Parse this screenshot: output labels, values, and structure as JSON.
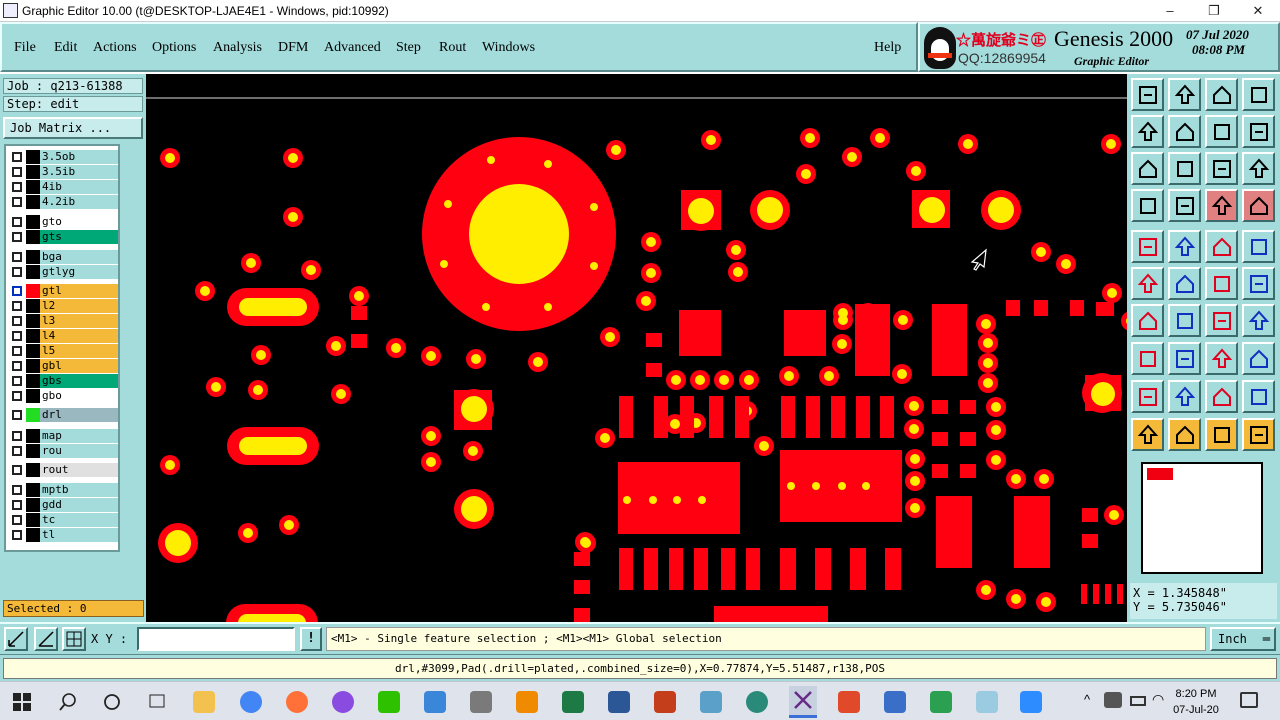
{
  "window": {
    "title": "Graphic Editor 10.00 (t@DESKTOP-LJAE4E1 - Windows, pid:10992)",
    "minimize_glyph": "–",
    "restore_glyph": "❐",
    "close_glyph": "✕"
  },
  "menu": [
    "File",
    "Edit",
    "Actions",
    "Options",
    "Analysis",
    "DFM",
    "Advanced",
    "Step",
    "Rout",
    "Windows",
    "Help"
  ],
  "brand": {
    "chinese": "☆萬旋爺ミ㊣",
    "qq": "QQ:12869954",
    "product": "Genesis 2000",
    "subtitle": "Graphic Editor",
    "date": "07 Jul 2020",
    "time": "08:08 PM"
  },
  "job": {
    "job_label": "Job : q213-61388",
    "step_label": "Step: edit",
    "matrix_button": "Job Matrix ..."
  },
  "layers": [
    {
      "name": "3.5ob",
      "color": "#a4dcdc",
      "swatch": "#000000"
    },
    {
      "name": "3.5ib",
      "color": "#a4dcdc",
      "swatch": "#000000"
    },
    {
      "name": "4ib",
      "color": "#a4dcdc",
      "swatch": "#000000"
    },
    {
      "name": "4.2ib",
      "color": "#a4dcdc",
      "swatch": "#000000"
    },
    {
      "name": "gto",
      "color": "#ffffff",
      "swatch": "#000000"
    },
    {
      "name": "gts",
      "color": "#00a878",
      "swatch": "#000000"
    },
    {
      "name": "bga",
      "color": "#a4dcdc",
      "swatch": "#000000"
    },
    {
      "name": "gtlyg",
      "color": "#a4dcdc",
      "swatch": "#000000"
    },
    {
      "name": "gtl",
      "color": "#f5b93a",
      "swatch": "#ff0010"
    },
    {
      "name": "l2",
      "color": "#f5b93a",
      "swatch": "#000000"
    },
    {
      "name": "l3",
      "color": "#f5b93a",
      "swatch": "#000000"
    },
    {
      "name": "l4",
      "color": "#f5b93a",
      "swatch": "#000000"
    },
    {
      "name": "l5",
      "color": "#f5b93a",
      "swatch": "#000000"
    },
    {
      "name": "gbl",
      "color": "#f5b93a",
      "swatch": "#000000"
    },
    {
      "name": "gbs",
      "color": "#00a878",
      "swatch": "#000000"
    },
    {
      "name": "gbo",
      "color": "#ffffff",
      "swatch": "#000000"
    },
    {
      "name": "drl",
      "color": "#9ab8c0",
      "swatch": "#22dd22"
    },
    {
      "name": "map",
      "color": "#a4dcdc",
      "swatch": "#000000"
    },
    {
      "name": "rou",
      "color": "#a4dcdc",
      "swatch": "#000000"
    },
    {
      "name": "rout",
      "color": "#e0e0e0",
      "swatch": "#000000"
    },
    {
      "name": "mptb",
      "color": "#a4dcdc",
      "swatch": "#000000"
    },
    {
      "name": "gdd",
      "color": "#a4dcdc",
      "swatch": "#000000"
    },
    {
      "name": "tc",
      "color": "#a4dcdc",
      "swatch": "#000000"
    },
    {
      "name": "tl",
      "color": "#a4dcdc",
      "swatch": "#000000"
    }
  ],
  "selected": "Selected : 0",
  "coords": {
    "x": "X = 1.345848\"",
    "y": "Y = 5.735046\""
  },
  "bottom": {
    "xy_label": "X Y :",
    "xy_value": "",
    "bang": "!",
    "hint": "<M1> - Single feature selection ; <M1><M1> Global selection",
    "unit": "Inch"
  },
  "status": "drl,#3099,Pad(.drill=plated,.combined_size=0),X=0.77874,Y=5.51487,r138,POS",
  "taskbar": {
    "time": "8:20 PM",
    "date": "07-Jul-20"
  },
  "colors": {
    "copper": "#ff0010",
    "drill": "#ffee00",
    "background": "#000000",
    "panel": "#a4dcdc"
  }
}
